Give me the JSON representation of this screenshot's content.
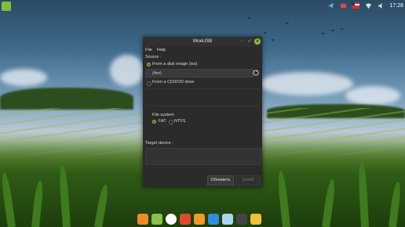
{
  "desktop": {
    "clock": "17:28"
  },
  "window": {
    "title": "WoeUSB",
    "menu": [
      "File",
      "Help"
    ],
    "source_label": "Source :",
    "option_iso": "From a disk image (iso)",
    "iso_value": "(Нет)",
    "option_cd": "From a CD/DVD drive",
    "filesystem_label": "File system",
    "fs_fat": "FAT",
    "fs_ntfs": "NTFS",
    "target_label": "Target device :",
    "refresh_button": "Обновить",
    "install_button": "Install"
  },
  "colors": {
    "accent": "#8fbf3f",
    "window_bg": "#2b2b2b"
  },
  "dock_icons": [
    "firefox-icon",
    "files-icon",
    "music-icon",
    "app-center-icon",
    "media-player-icon",
    "camera-icon",
    "web-app-icon",
    "tools-icon",
    "gear-icon"
  ]
}
